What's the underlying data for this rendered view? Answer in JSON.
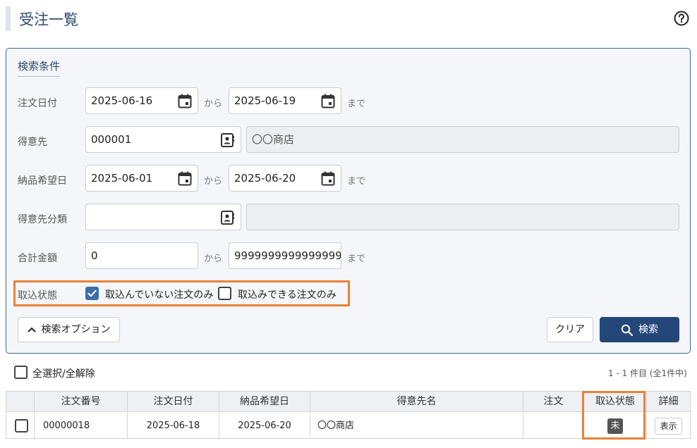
{
  "header": {
    "title": "受注一覧"
  },
  "search": {
    "title": "検索条件",
    "sep_from": "から",
    "sep_to": "まで",
    "order_date": {
      "label": "注文日付",
      "from": "2025-06-16",
      "to": "2025-06-19"
    },
    "customer": {
      "label": "得意先",
      "code": "000001",
      "name": "〇〇商店"
    },
    "delivery_date": {
      "label": "納品希望日",
      "from": "2025-06-01",
      "to": "2025-06-20"
    },
    "customer_category": {
      "label": "得意先分類",
      "code": "",
      "name": ""
    },
    "total_amount": {
      "label": "合計金額",
      "from": "0",
      "to": "9999999999999999"
    },
    "import_status": {
      "label": "取込状態",
      "options": [
        {
          "label": "取込んでいない注文のみ",
          "checked": true
        },
        {
          "label": "取込みできる注文のみ",
          "checked": false
        }
      ]
    },
    "options_button": "検索オプション",
    "clear_button": "クリア",
    "search_button": "検索"
  },
  "results": {
    "select_all_label": "全選択/全解除",
    "count_text": "1 - 1 件目 (全1件中)",
    "columns": [
      "注文番号",
      "注文日付",
      "納品希望日",
      "得意先名",
      "注文",
      "取込状態",
      "詳細"
    ],
    "rows": [
      {
        "order_no": "00000018",
        "order_date": "2025-06-18",
        "delivery_date": "2025-06-20",
        "customer_name": "〇〇商店",
        "order": "",
        "status": "未",
        "detail": "表示"
      }
    ]
  },
  "colors": {
    "accent": "#24477a",
    "highlight": "#e8823a",
    "panel_border": "#3e6a8f"
  }
}
